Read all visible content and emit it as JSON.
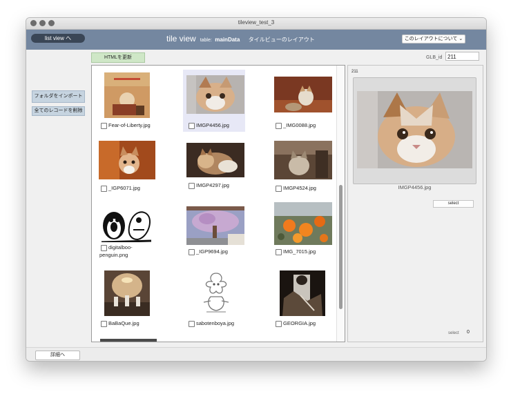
{
  "window": {
    "title": "tileview_test_3"
  },
  "header": {
    "list_view_button": "list view へ",
    "title_main": "tile view",
    "table_prefix": "table:",
    "table_name": "mainData",
    "layout_name": "タイルビューのレイアウト",
    "about_button": "このレイアウトについて ⌄"
  },
  "toolbar": {
    "update_html_button": "HTMLを更新",
    "glb_label": "GLB_id",
    "glb_value": "211"
  },
  "sidebar": {
    "import_folder_button": "フォルダをインポート",
    "delete_all_button": "全てのレコードを削除"
  },
  "tiles": [
    {
      "filename": "Fear-of-Liberty.jpg"
    },
    {
      "filename": "IMGP4456.jpg"
    },
    {
      "filename": "_IMG0088.jpg"
    },
    {
      "filename": "_IGP6071.jpg"
    },
    {
      "filename": "IMGP4297.jpg"
    },
    {
      "filename": "IMGP4524.jpg"
    },
    {
      "filename_line1": "digitalboo-",
      "filename_line2": "penguin.png"
    },
    {
      "filename": "_IGP9694.jpg"
    },
    {
      "filename": "IMG_7015.jpg"
    },
    {
      "filename": "BaBaQue.jpg"
    },
    {
      "filename": "sabotenboya.jpg"
    },
    {
      "filename": "GEORGIA.jpg"
    }
  ],
  "detail": {
    "id": "211",
    "filename": "IMGP4456.jpg",
    "select_button": "select",
    "selected_label": "select",
    "selected_count": "0"
  },
  "footer": {
    "detail_button": "詳細へ"
  },
  "colors": {
    "header_bg": "#7487a0",
    "list_button_bg": "#3a4656",
    "side_button_bg": "#c6d4e0",
    "update_button_bg": "#cfe7c7"
  }
}
